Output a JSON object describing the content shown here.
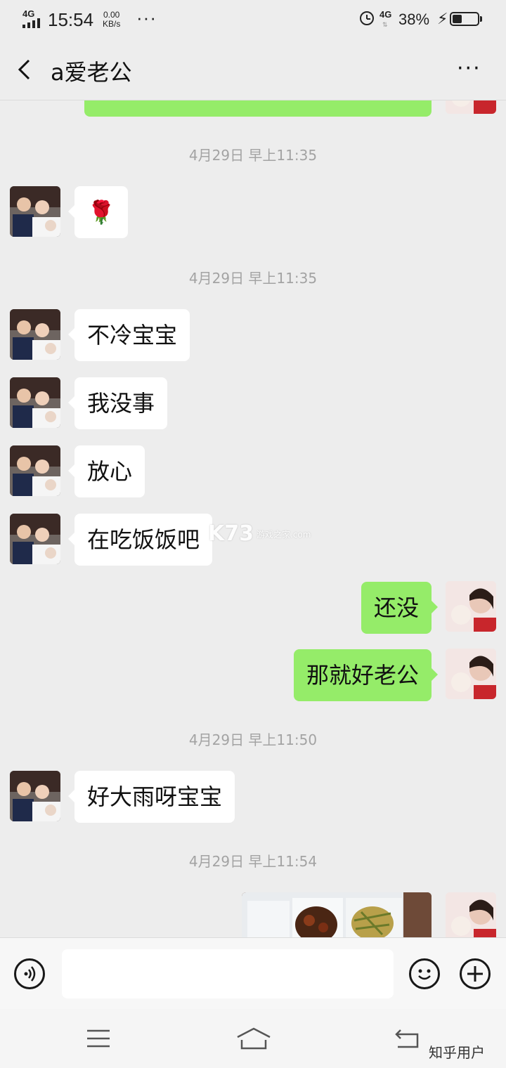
{
  "status_bar": {
    "network": "4G",
    "time": "15:54",
    "speed_value": "0.00",
    "speed_unit": "KB/s",
    "more": "···",
    "network2": "4G",
    "battery_percent": "38%",
    "battery_level": 0.38
  },
  "header": {
    "title": "a爱老公",
    "more": "···"
  },
  "messages": {
    "partial_top": {
      "side": "right"
    },
    "ts1": "4月29日 早上11:35",
    "rose": {
      "emoji": "🌹"
    },
    "ts2": "4月29日 早上11:35",
    "m1": "不冷宝宝",
    "m2": "我没事",
    "m3": "放心",
    "m4": "在吃饭饭吧",
    "m5": "还没",
    "m6": "那就好老公",
    "ts3": "4月29日 早上11:50",
    "m7": "好大雨呀宝宝",
    "ts4": "4月29日 早上11:54"
  },
  "watermark": {
    "logo": "K73",
    "sub": "游戏之家",
    "sub2": ".com"
  },
  "credit": "知乎用户",
  "colors": {
    "bubble_sent": "#95ec69",
    "bubble_received": "#ffffff",
    "background": "#ededed"
  }
}
